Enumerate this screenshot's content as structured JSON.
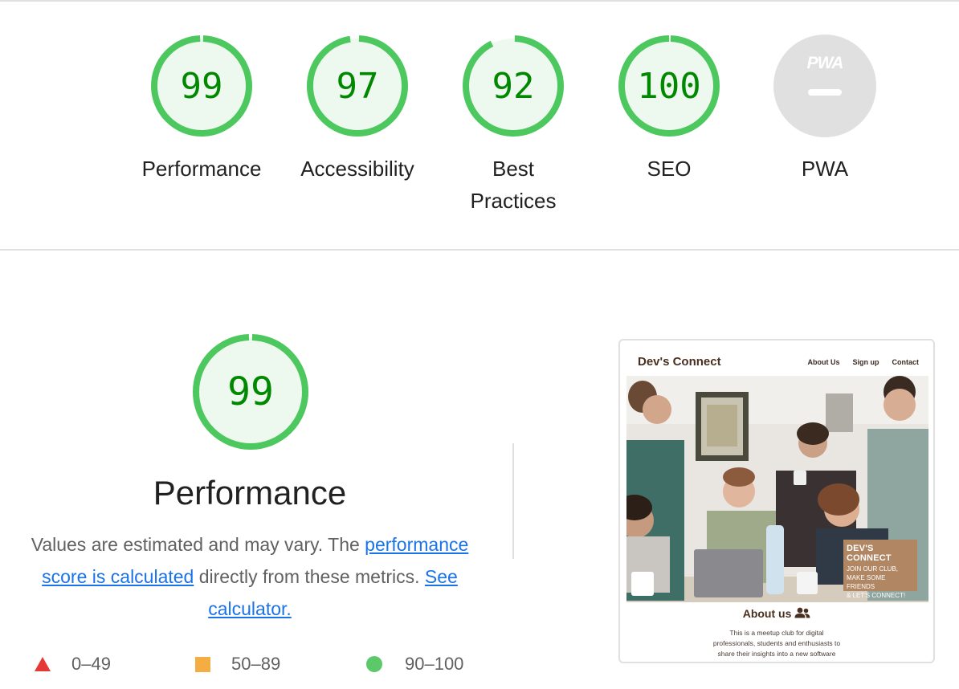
{
  "summary": {
    "categories": [
      {
        "label": "Performance",
        "score": "99",
        "fraction": 0.99
      },
      {
        "label": "Accessibility",
        "score": "97",
        "fraction": 0.97
      },
      {
        "label": "Best Practices",
        "score": "92",
        "fraction": 0.92
      },
      {
        "label": "SEO",
        "score": "100",
        "fraction": 1.0
      },
      {
        "label": "PWA",
        "badge_text": "PWA"
      }
    ]
  },
  "performance": {
    "score": "99",
    "fraction": 0.99,
    "title": "Performance",
    "description_prefix": "Values are estimated and may vary. The",
    "link_score": "performance score is calculated",
    "description_middle": "directly from these metrics.",
    "link_calculator": "See calculator."
  },
  "legend": [
    {
      "range": "0–49",
      "shape": "triangle",
      "color": "#e53935"
    },
    {
      "range": "50–89",
      "shape": "square",
      "color": "#f4ad42"
    },
    {
      "range": "90–100",
      "shape": "circle",
      "color": "#5bc96a"
    }
  ],
  "screenshot": {
    "brand": "Dev's Connect",
    "nav": [
      "About Us",
      "Sign up",
      "Contact"
    ],
    "badge_title": "DEV'S CONNECT",
    "badge_lines": [
      "JOIN OUR CLUB,",
      "MAKE SOME FRIENDS",
      "& LET'S CONNECT!"
    ],
    "about_heading": "About us",
    "about_lines": [
      "This is a meetup club for digital",
      "professionals, students and enthusiasts to",
      "share their insights into a new software"
    ]
  },
  "colors": {
    "pass_arc": "#4cc85f",
    "pass_fill": "#edf8ee",
    "pass_text": "#008800",
    "na_fill": "#e0e0e0",
    "link": "#1a73e8"
  }
}
